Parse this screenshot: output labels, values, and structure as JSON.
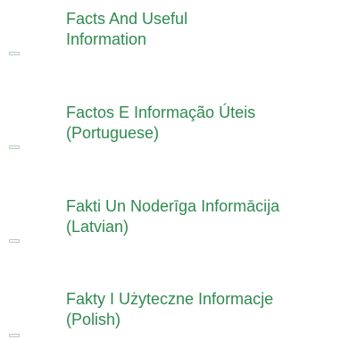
{
  "links": [
    {
      "line1": "Facts And Useful",
      "line2": "Information"
    },
    {
      "line1": "Factos E Informação Úteis",
      "line2": "(Portuguese)"
    },
    {
      "line1": "Fakti Un Noderīga Informācija",
      "line2": "(Latvian)"
    },
    {
      "line1": "Fakty I Użyteczne Informacje",
      "line2": "(Polish)"
    }
  ],
  "colors": {
    "link": "#2f8a4f",
    "bullet_border": "#b9cbb9"
  }
}
